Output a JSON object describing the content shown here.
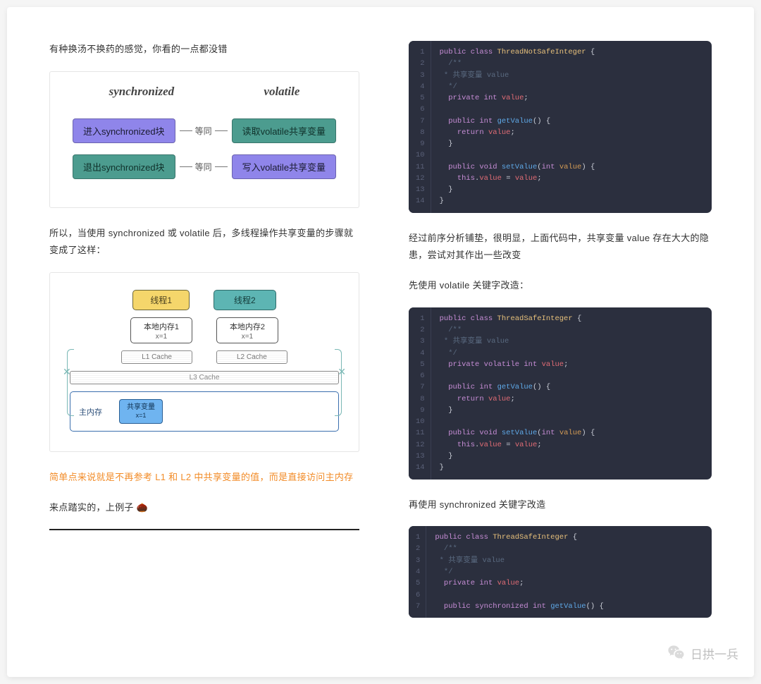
{
  "left": {
    "p1": "有种换汤不换药的感觉，你看的一点都没错",
    "d1": {
      "hsync": "synchronized",
      "hvol": "volatile",
      "r1a": "进入synchronized块",
      "r1lbl": "等同",
      "r1b": "读取volatile共享变量",
      "r2a": "退出synchronized块",
      "r2lbl": "等同",
      "r2b": "写入volatile共享变量"
    },
    "p2": "所以，当使用 synchronized 或 volatile 后，多线程操作共享变量的步骤就变成了这样：",
    "d2": {
      "t1": "线程1",
      "t2": "线程2",
      "m1": "本地内存1",
      "m1s": "x=1",
      "m2": "本地内存2",
      "m2s": "x=1",
      "c1": "L1 Cache",
      "c2": "L2 Cache",
      "l3": "L3 Cache",
      "main": "主内存",
      "shared": "共享变量",
      "shareds": "x=1"
    },
    "p3": "简单点来说就是不再参考 L1 和 L2 中共享变量的值，而是直接访问主内存",
    "p4": "来点踏实的，上例子 🌰"
  },
  "right": {
    "code1": {
      "class": "ThreadNotSafeInteger",
      "comment": " * 共享变量 value",
      "decl": "private int value;",
      "get": "public int getValue() {",
      "getret": "    return value;",
      "set": "public void setValue(int value) {",
      "setbody": "    this.value = value;"
    },
    "p_after1": "经过前序分析铺垫，很明显，上面代码中，共享变量 value 存在大大的隐患，尝试对其作出一些改变",
    "p_vol": "先使用 volatile 关键字改造：",
    "code2": {
      "class": "ThreadSafeInteger",
      "comment": " * 共享变量 value",
      "decl": "private volatile int value;",
      "get": "public int getValue() {",
      "getret": "    return value;",
      "set": "public void setValue(int value) {",
      "setbody": "    this.value = value;"
    },
    "p_sync": "再使用 synchronized 关键字改造",
    "code3": {
      "class": "ThreadSafeInteger",
      "comment": " * 共享变量 value",
      "decl": "private int value;",
      "get": "public synchronized int getValue() {"
    }
  },
  "wechat": "日拱一兵"
}
